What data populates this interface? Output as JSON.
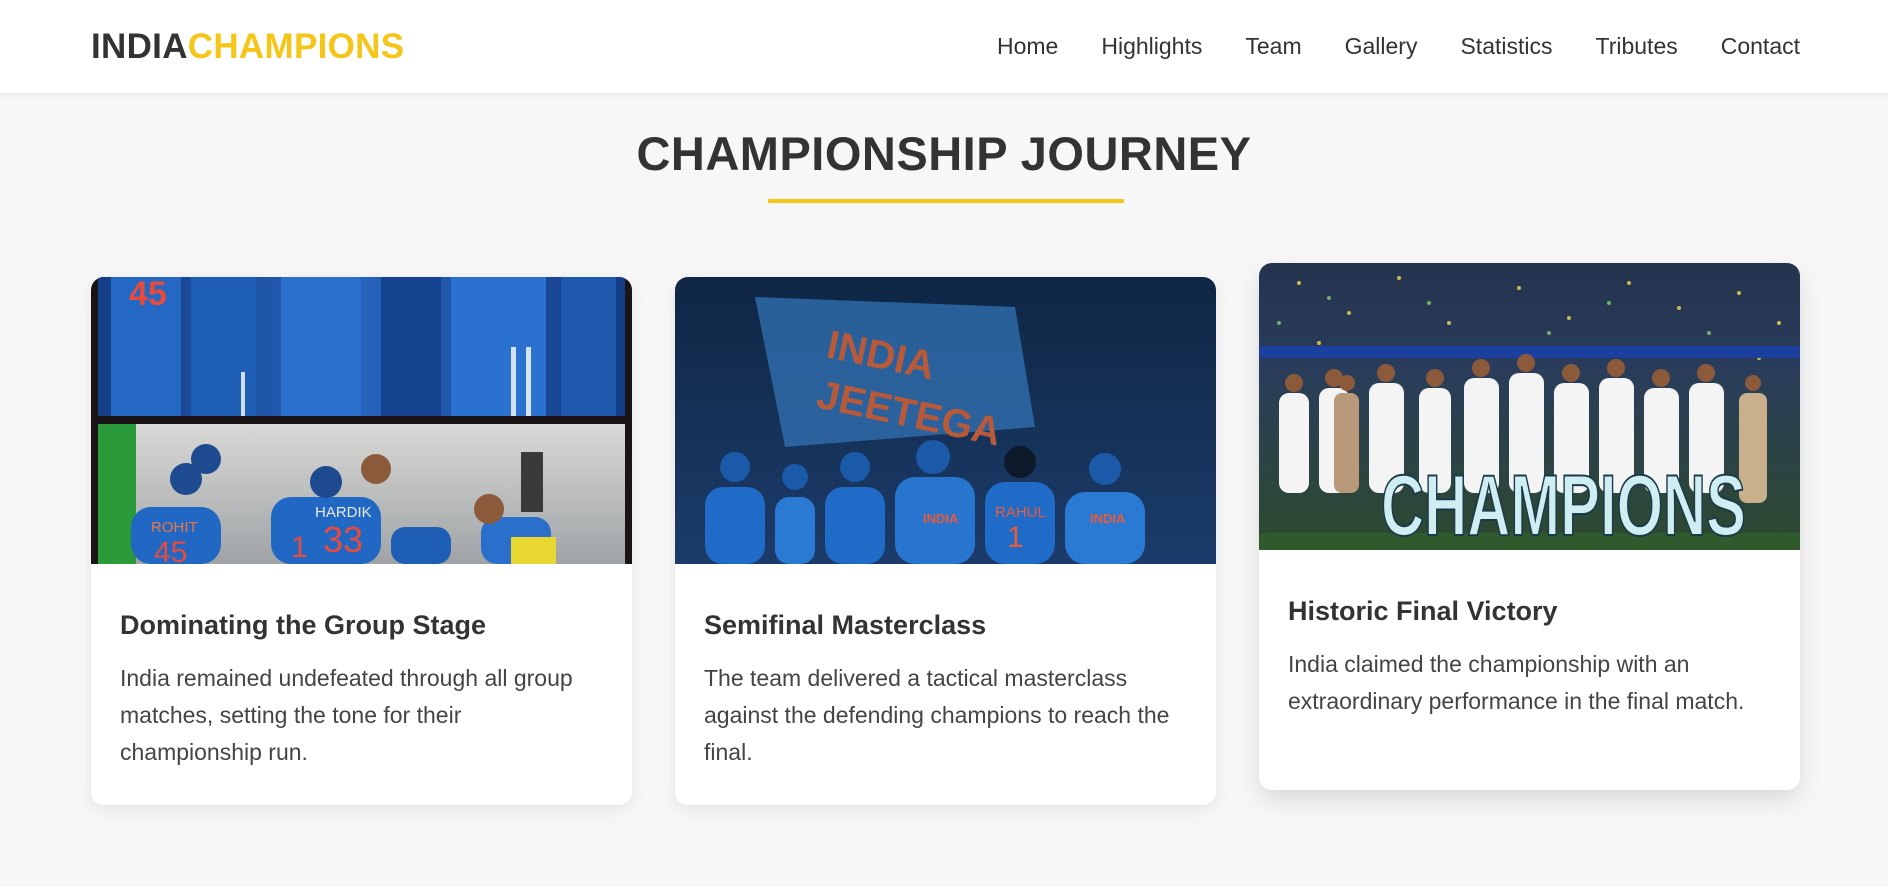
{
  "brand": {
    "part1": "INDIA",
    "part2": "CHAMPIONS",
    "accent_color": "#f5c518"
  },
  "nav": {
    "items": [
      {
        "label": "Home"
      },
      {
        "label": "Highlights"
      },
      {
        "label": "Team"
      },
      {
        "label": "Gallery"
      },
      {
        "label": "Statistics"
      },
      {
        "label": "Tributes"
      },
      {
        "label": "Contact"
      }
    ]
  },
  "section": {
    "title": "CHAMPIONSHIP JOURNEY"
  },
  "cards": [
    {
      "title": "Dominating the Group Stage",
      "text": "India remained undefeated through all group matches, setting the tone for their championship run.",
      "image": {
        "shirt_numbers": [
          "45",
          "33",
          "1",
          "45"
        ],
        "shirt_names": [
          "ROHIT",
          "HARDIK"
        ]
      }
    },
    {
      "title": "Semifinal Masterclass",
      "text": "The team delivered a tactical masterclass against the defending champions to reach the final.",
      "image": {
        "flag_text_1": "INDIA",
        "flag_text_2": "JEETEGA",
        "shirt_text": "INDIA",
        "shirt_name": "RAHUL",
        "shirt_number": "1"
      }
    },
    {
      "title": "Historic Final Victory",
      "text": "India claimed the championship with an extraordinary performance in the final match.",
      "image": {
        "banner_text": "CHAMPIONS"
      }
    }
  ]
}
